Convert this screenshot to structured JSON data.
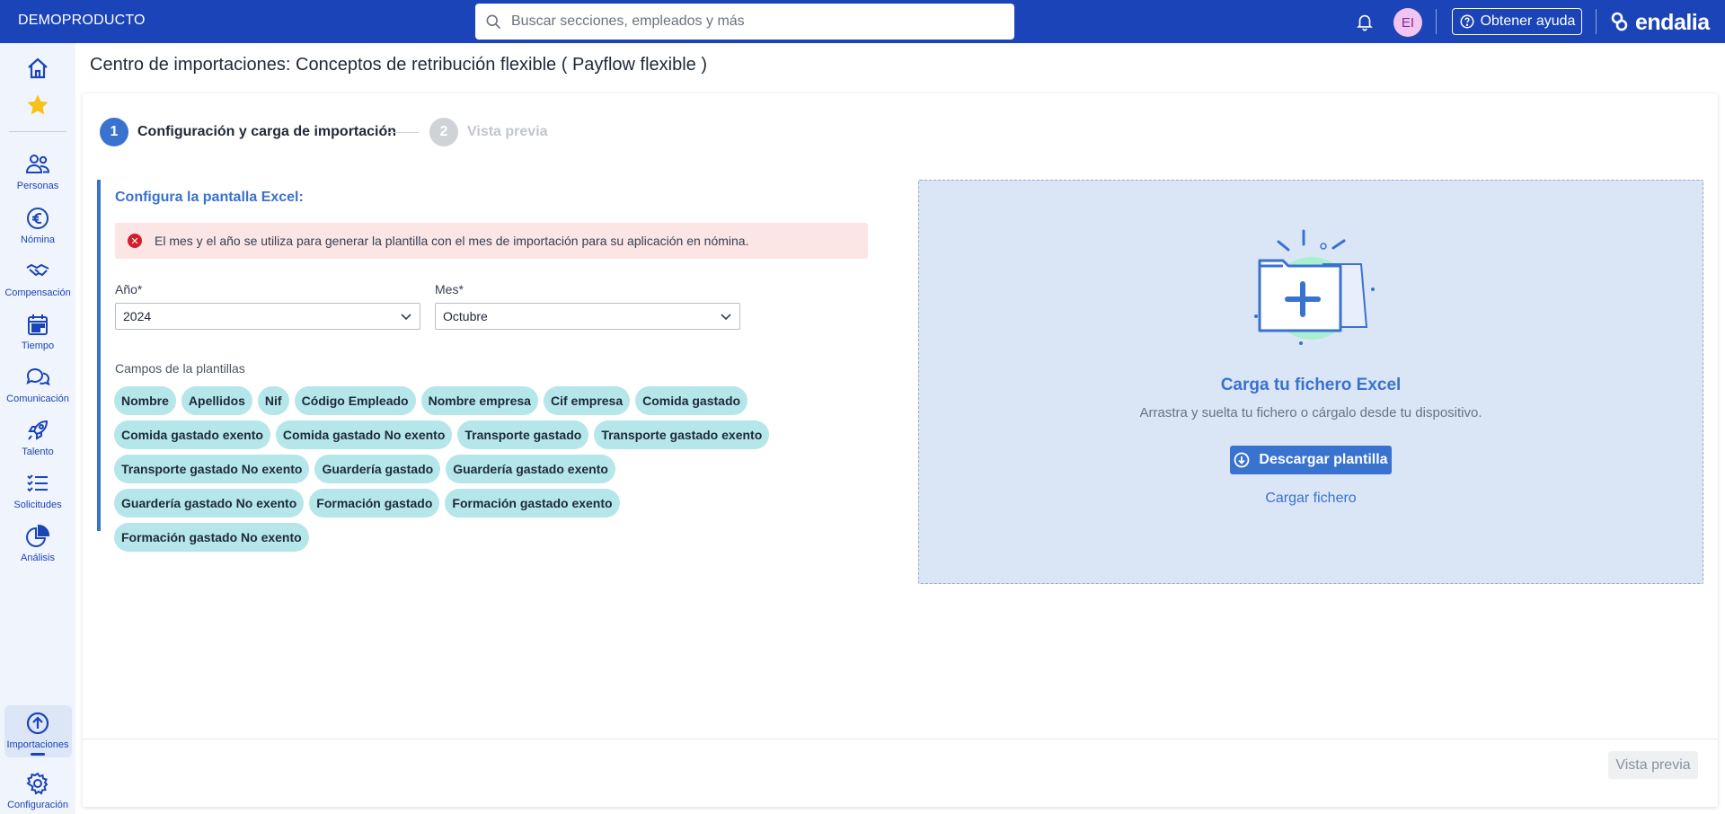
{
  "topbar": {
    "brand": "DEMOPRODUCTO",
    "search_placeholder": "Buscar secciones, empleados y más",
    "avatar_initials": "EI",
    "help_label": "Obtener ayuda",
    "logo_text": "endalia"
  },
  "sidebar": {
    "items": [
      {
        "label": "",
        "icon": "home-icon"
      },
      {
        "label": "",
        "icon": "star-icon"
      },
      {
        "label": "Personas",
        "icon": "people-icon"
      },
      {
        "label": "Nómina",
        "icon": "euro-icon"
      },
      {
        "label": "Compensación",
        "icon": "handshake-icon"
      },
      {
        "label": "Tiempo",
        "icon": "calendar-icon"
      },
      {
        "label": "Comunicación",
        "icon": "chat-icon"
      },
      {
        "label": "Talento",
        "icon": "rocket-icon"
      },
      {
        "label": "Solicitudes",
        "icon": "checklist-icon"
      },
      {
        "label": "Análisis",
        "icon": "pie-chart-icon"
      },
      {
        "label": "Importaciones",
        "icon": "upload-icon"
      },
      {
        "label": "Configuración",
        "icon": "gear-icon"
      }
    ]
  },
  "page": {
    "title": "Centro de importaciones: Conceptos de retribución flexible ( Payflow flexible )"
  },
  "steps": [
    {
      "number": "1",
      "label": "Configuración y carga de importación"
    },
    {
      "number": "2",
      "label": "Vista previa"
    }
  ],
  "config": {
    "title": "Configura la pantalla Excel:",
    "alert": "El mes y el año se utiliza para generar la plantilla con el mes de importación para su aplicación en nómina.",
    "year_label": "Año*",
    "year_value": "2024",
    "month_label": "Mes*",
    "month_value": "Octubre",
    "fields_label": "Campos de la plantillas",
    "fields": [
      "Nombre",
      "Apellidos",
      "Nif",
      "Código Empleado",
      "Nombre empresa",
      "Cif empresa",
      "Comida gastado",
      "Comida gastado exento",
      "Comida gastado No exento",
      "Transporte gastado",
      "Transporte gastado exento",
      "Transporte gastado No exento",
      "Guardería gastado",
      "Guardería gastado exento",
      "Guardería gastado No exento",
      "Formación gastado",
      "Formación gastado exento",
      "Formación gastado No exento"
    ]
  },
  "upload": {
    "title": "Carga tu fichero Excel",
    "subtitle": "Arrastra y suelta tu fichero o cárgalo desde tu dispositivo.",
    "download_label": "Descargar plantilla",
    "upload_link": "Cargar fichero"
  },
  "footer": {
    "next_label": "Vista previa"
  },
  "colors": {
    "primary": "#1a44b8",
    "accent": "#3a72d0",
    "chip": "#b4e6ea",
    "alert_bg": "#fbe5e5",
    "drop_bg": "#dae6f5"
  }
}
